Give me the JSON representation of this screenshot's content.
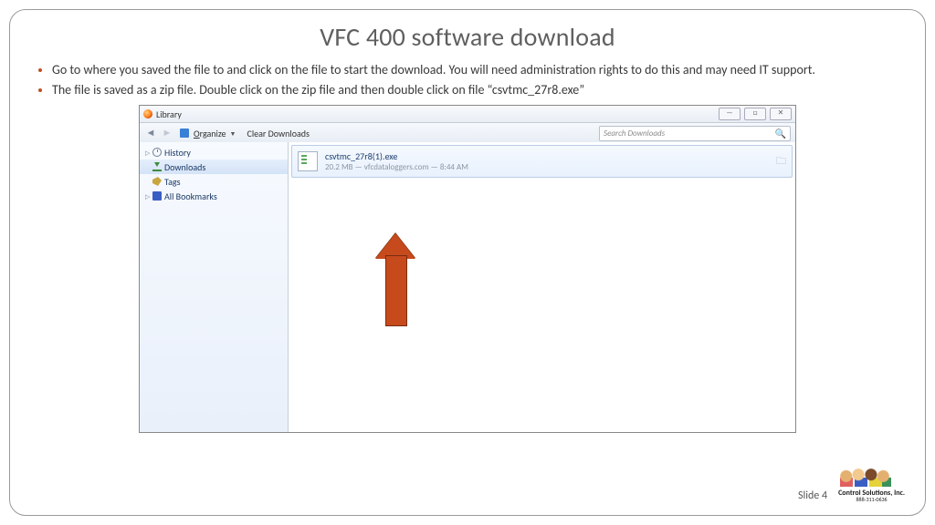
{
  "title": "VFC 400 software download",
  "bullets": [
    "Go to where you saved the file to and click on the file to start the download. You will need administration rights to do this and may need IT support.",
    "The file is saved as a zip file. Double click on the zip file and then double click on file “csvtmc_27r8.exe”"
  ],
  "library": {
    "window_title": "Library",
    "toolbar": {
      "organize": "Organize",
      "clear": "Clear Downloads",
      "search_placeholder": "Search Downloads"
    },
    "sidebar": [
      {
        "label": "History"
      },
      {
        "label": "Downloads"
      },
      {
        "label": "Tags"
      },
      {
        "label": "All Bookmarks"
      }
    ],
    "download": {
      "filename": "csvtmc_27r8(1).exe",
      "meta": "20.2 MB — vfcdataloggers.com — 8:44 AM"
    }
  },
  "footer": {
    "slide": "Slide 4",
    "company": "Control Solutions, Inc.",
    "phone": "888-311-0636"
  }
}
